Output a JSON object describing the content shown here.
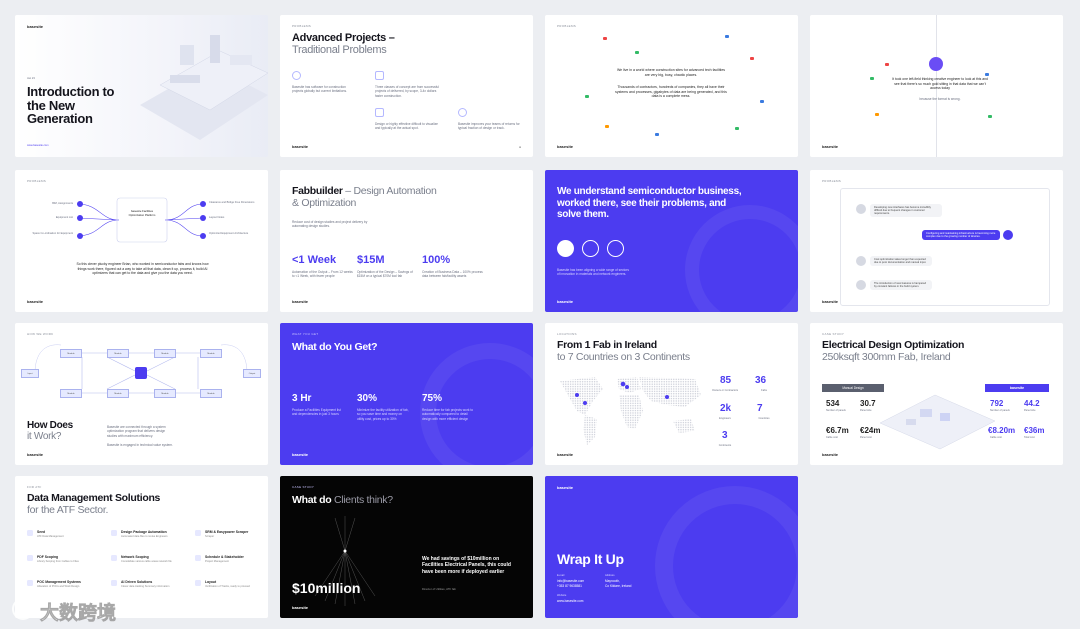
{
  "brand": "basesite",
  "slides": {
    "s1": {
      "small_date": "Jan 23",
      "title": "Introduction to the New Generation",
      "url": "www.basesite.com"
    },
    "s2": {
      "tag": "PROBLEMS",
      "title_a": "Advanced Projects –",
      "title_b": "Traditional Problems",
      "items": [
        "Basesite has software for construction projects globally but current limitations.",
        "Three classes of concept are from successful projects of delivered, by scope, 3-4x dollars faster construction.",
        "Design or highly effective difficult to visualize and typically at the actual spot.",
        "Basesite improves your teams of returns for typical fraction of design or track."
      ]
    },
    "s3": {
      "tag": "PROBLEMS",
      "p1": "We live in a world where construction sites for advanced tech facilities are very big, busy, chaotic places.",
      "p2": "Thousands of contractors, hundreds of companies, they all have their systems and processes, gigabytes of data are being generated, and this data is a complete mess."
    },
    "s4": {
      "p1": "It took one left-field thinking creative engineer to look at this and see that there's so much gold sitting in that data that we can't access today",
      "p2": "because the format is wrong."
    },
    "s5": {
      "tag": "PROBLEMS",
      "left": [
        "BIM, Assignments",
        "Equipment List",
        "Space Co-ordination for Equipment"
      ],
      "center": "basesite Facilities Optimization Platform",
      "right": [
        "Clearance and Bridge Free Dimensions",
        "Layout Notes",
        "Optimized Equipment Architecture"
      ],
      "text": "So this clever plucky engineer Brian, who worked in semiconductor fabs and knows how things work there, figured out a way to take all that data, clean it up, process it, build AI optimizers that can get to the data and give you the data you need."
    },
    "s6": {
      "title_a": "Fabbuilder",
      "title_b": " – Design Automation",
      "title_c": "& Optimization",
      "d1": "Reduce cost of design studies and project delivery by automating design studies.",
      "stats": [
        {
          "v": "<1 Week",
          "d": "Automation of the Output – From 12 weeks to <1 Week, with fewer people"
        },
        {
          "v": "$15M",
          "d": "Optimization of the Design – Savings of $15M on a typical $70M tool fab"
        },
        {
          "v": "100%",
          "d": "Creation of Business Data – 100% process data between fab/facility assets"
        }
      ]
    },
    "s7": {
      "title": "We understand semiconductor business, worked there, see their problems, and solve them.",
      "foot": "Basesite has been aligning a wide range of sectors of innovation in materials and network engineers."
    },
    "s8": {
      "tag": "PROBLEMS",
      "bubbles": [
        "Developing new interfaces has become incredibly difficult due to frequent changes in customer requirements.",
        "Configuring and maintaining infrastructure is becoming more complex due to the growing number of devices.",
        "Cost optimization takes longer than expected due to poor documentation and manual input.",
        "The introduction of new features is hampered by constant failures in the build system."
      ]
    },
    "s9": {
      "tag": "HOW WE WORK",
      "title_a": "How Does",
      "title_b": "it Work?",
      "d1": "Basesite are connected through a system optimization program that delivers design studies with maximum efficiency.",
      "d2": "Basesite is engaged in technical value system."
    },
    "s10": {
      "tag": "WHAT YOU GET",
      "title": "What do You Get?",
      "stats": [
        {
          "v": "3 Hr",
          "d": "Produce a Facilities Equipment list and dependencies in just 3 hours"
        },
        {
          "v": "30%",
          "d": "Minimize the facility utilization of fab, so you save time and money on utility cost, prices up to 30%"
        },
        {
          "v": "75%",
          "d": "Reduce time for fab projects work to automatically compared to detail design with more efficient design"
        }
      ]
    },
    "s11": {
      "tag": "LOCATIONS",
      "title_a": "From 1 Fab in Ireland",
      "title_b": "to 7 Countries on 3 Continents",
      "stats": [
        {
          "v": "85",
          "d": "Owners or Contractors"
        },
        {
          "v": "36",
          "d": "Fabs"
        },
        {
          "v": "2k",
          "d": "Engineers"
        },
        {
          "v": "7",
          "d": "Countries"
        },
        {
          "v": "3",
          "d": "Continents"
        }
      ]
    },
    "s12": {
      "tag": "CASE STUDY",
      "title_a": "Electrical Design Optimization",
      "title_b": "250ksqft 300mm Fab, Ireland",
      "manual": "Manual Design",
      "bs": "basesite",
      "left": [
        {
          "v": "534",
          "d": "Number of panels"
        },
        {
          "v": "30.7",
          "d": "Panel size"
        },
        {
          "v": "€6.7m",
          "d": "Cable cost"
        },
        {
          "v": "€24m",
          "d": "Panel cost"
        }
      ],
      "right": [
        {
          "v": "792",
          "d": "Number of panels"
        },
        {
          "v": "44.2",
          "d": "Panel size"
        },
        {
          "v": "€8.20m",
          "d": "Cable cost"
        },
        {
          "v": "€36m",
          "d": "Total cost"
        }
      ]
    },
    "s13": {
      "tag": "FOR ATF",
      "title_a": "Data Management Solutions",
      "title_b": "for the ATF Sector.",
      "items": [
        {
          "t": "Seed",
          "d": "ATF Data Management"
        },
        {
          "t": "Design Package Automation",
          "d": "Automated data files to revise Engineers"
        },
        {
          "t": "SRM & Easypower Scraper",
          "d": "Scraper"
        },
        {
          "t": "PDF Scoping",
          "d": "Library Scoping from Cables to Files"
        },
        {
          "t": "Network Scoping",
          "d": "Consolidate various cable areas network file"
        },
        {
          "t": "Schedule & Stakeholder",
          "d": "Project Management"
        },
        {
          "t": "POC Management Systems",
          "d": "Allocation of POCs and Work Design"
        },
        {
          "t": "AI Driven Solutions",
          "d": "Clever data tracking Summary information"
        },
        {
          "t": "Layout",
          "d": "Verification of Tracks, ready to proceed"
        }
      ]
    },
    "s14": {
      "tag": "CASE STUDY",
      "title_a": "What do ",
      "title_b": "Clients think?",
      "quote": "We had savings of $10million on Facilities Electrical Panels, this could have been more if deployed earlier",
      "who": "Director of Utilities, ATF fab",
      "big": "$10million"
    },
    "s15": {
      "title": "Wrap It Up",
      "l1": "E-mail",
      "email": "info@basesite.com",
      "phone": "+353 87 9638581",
      "l2": "Address",
      "a1": "Maynooth,",
      "a2": "Co Kildare, Ireland",
      "l3": "Website",
      "web": "www.basesite.com"
    }
  },
  "watermark": "大数跨境",
  "colors": {
    "accent": "#4c3cf0",
    "dark": "#15151d",
    "gray": "#7a7f8c"
  }
}
